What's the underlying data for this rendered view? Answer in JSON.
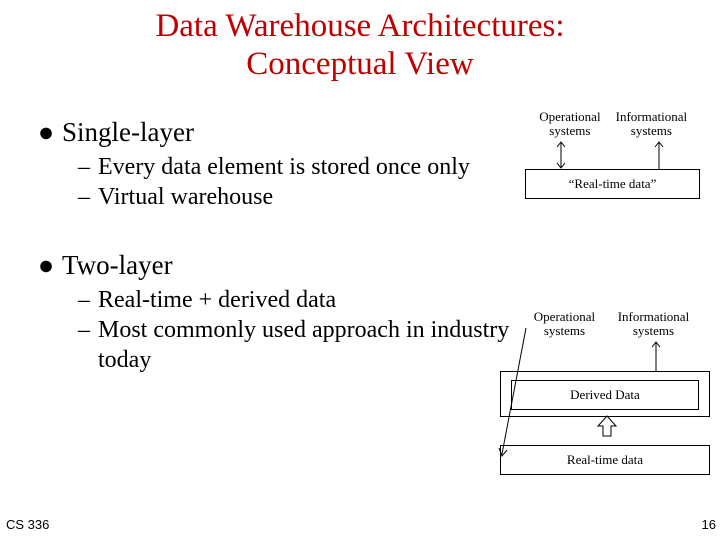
{
  "title_line1": "Data Warehouse Architectures:",
  "title_line2": "Conceptual View",
  "bullets": {
    "single": "Single-layer",
    "single_sub1": "Every data element is stored once only",
    "single_sub2": "Virtual warehouse",
    "two": "Two-layer",
    "two_sub1": "Real-time + derived data",
    "two_sub2": "Most commonly used approach in industry today"
  },
  "diag1": {
    "op": "Operational systems",
    "info": "Informational systems",
    "box": "“Real-time data”"
  },
  "diag2": {
    "op": "Operational systems",
    "info": "Informational systems",
    "derived": "Derived Data",
    "rt": "Real-time data"
  },
  "footer": {
    "course": "CS 336",
    "page": "16"
  }
}
